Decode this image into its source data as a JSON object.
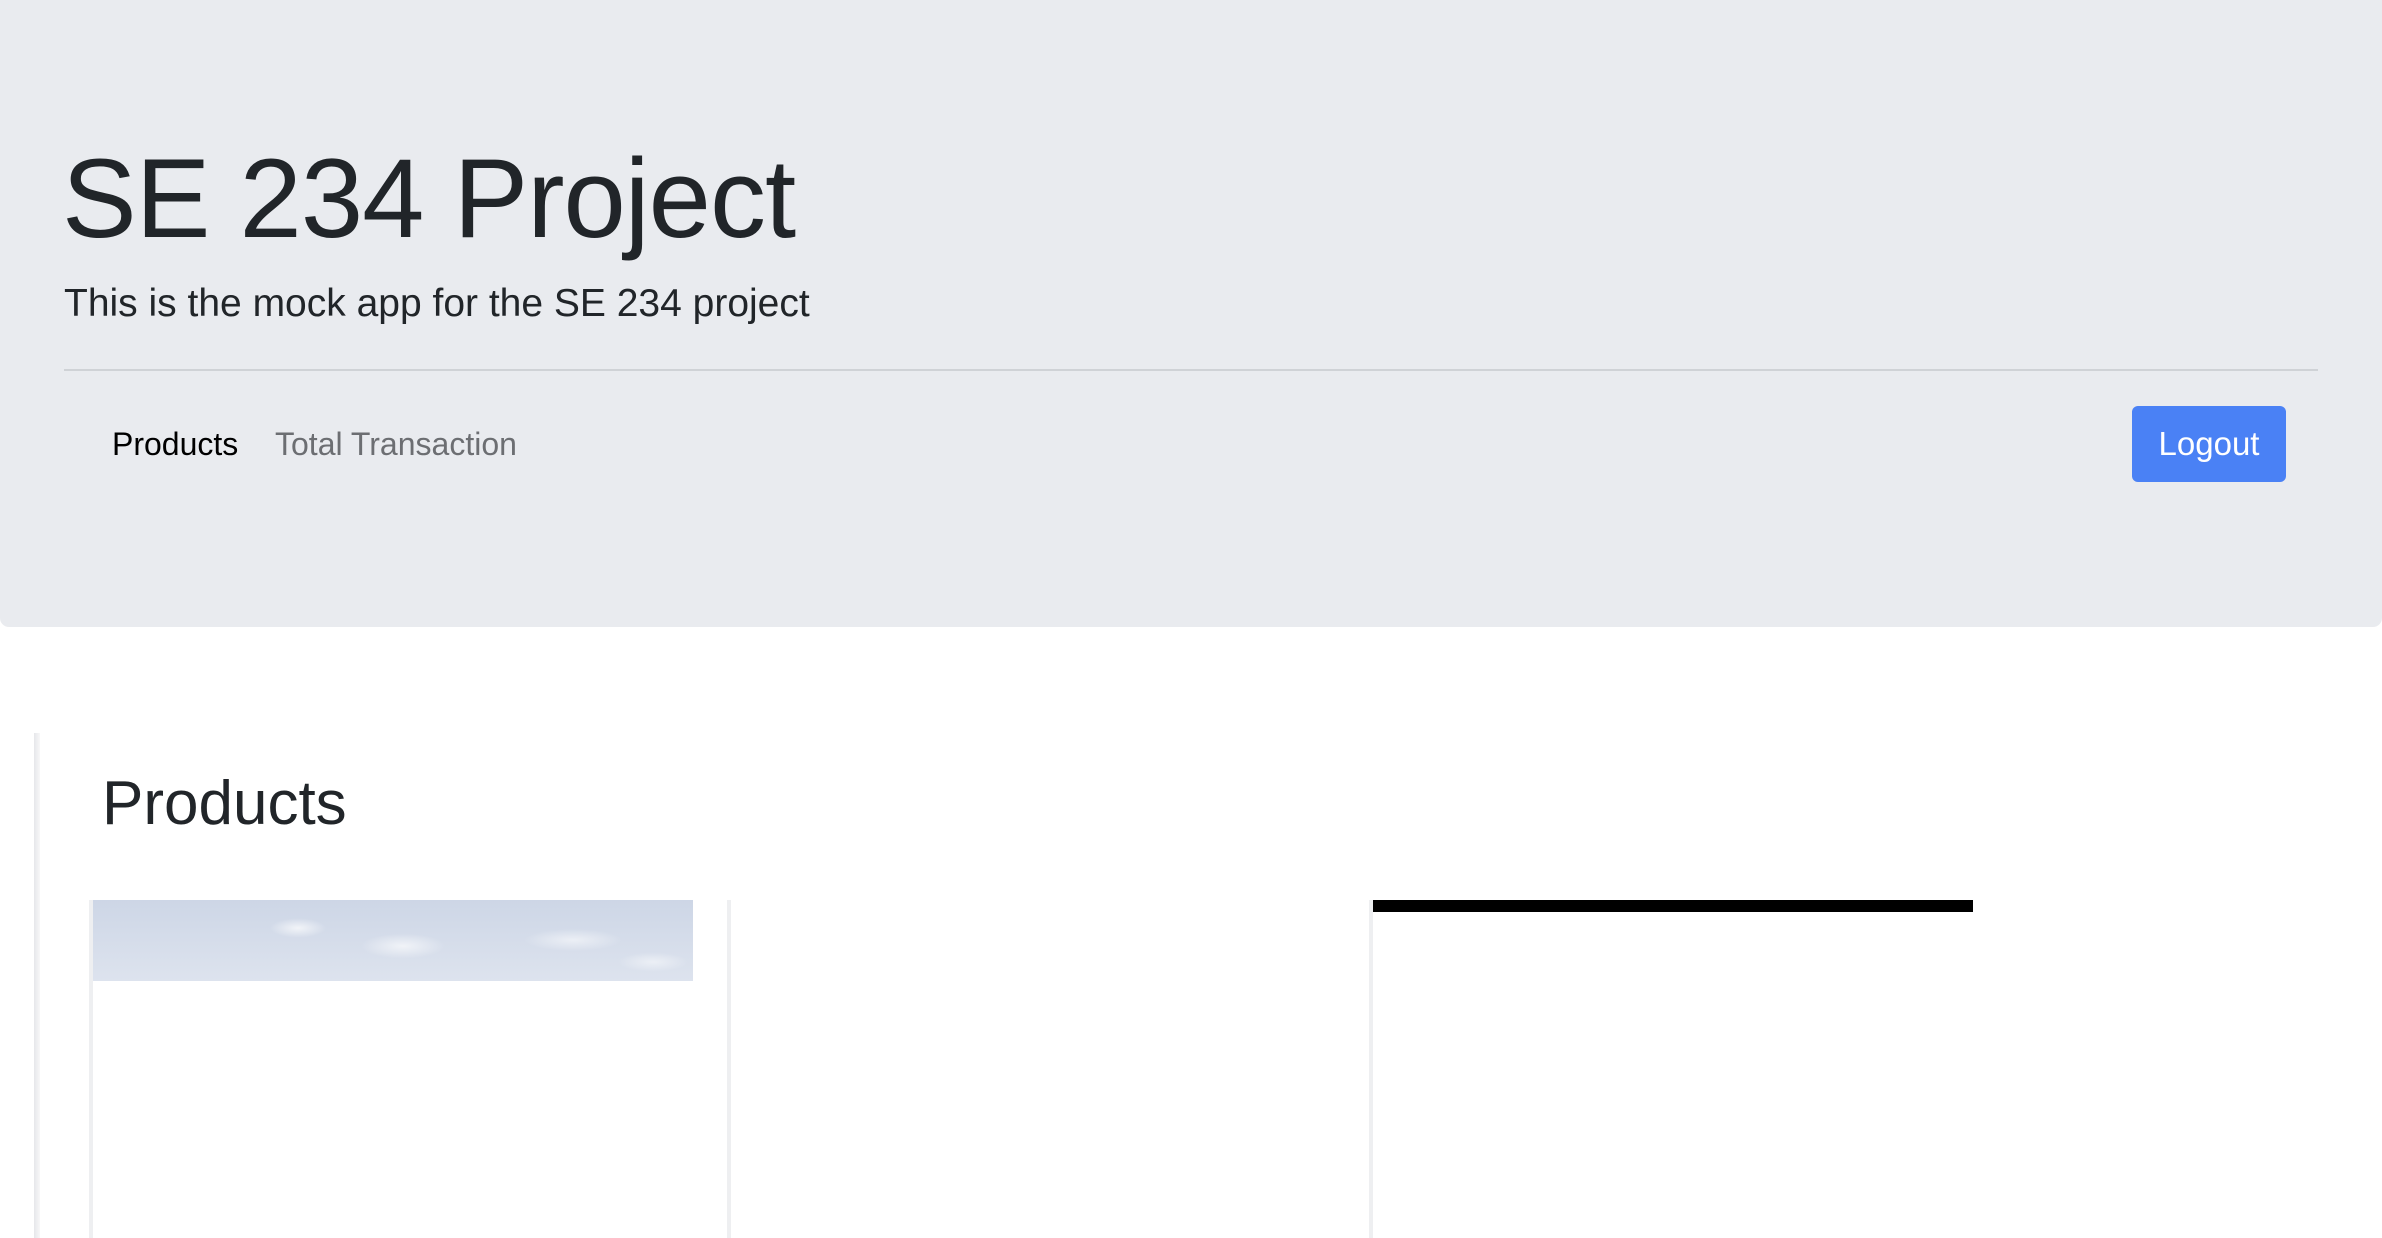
{
  "header": {
    "title": "SE 234 Project",
    "lead": "This is the mock app for the SE 234 project"
  },
  "nav": {
    "items": [
      {
        "label": "Products",
        "active": true
      },
      {
        "label": "Total Transaction",
        "active": false
      }
    ],
    "logout_label": "Logout"
  },
  "products": {
    "heading": "Products"
  },
  "colors": {
    "jumbotron_bg": "#e9ebef",
    "primary": "#4a81f5",
    "nav_active": "#000000",
    "nav_inactive": "#6c6e72"
  }
}
